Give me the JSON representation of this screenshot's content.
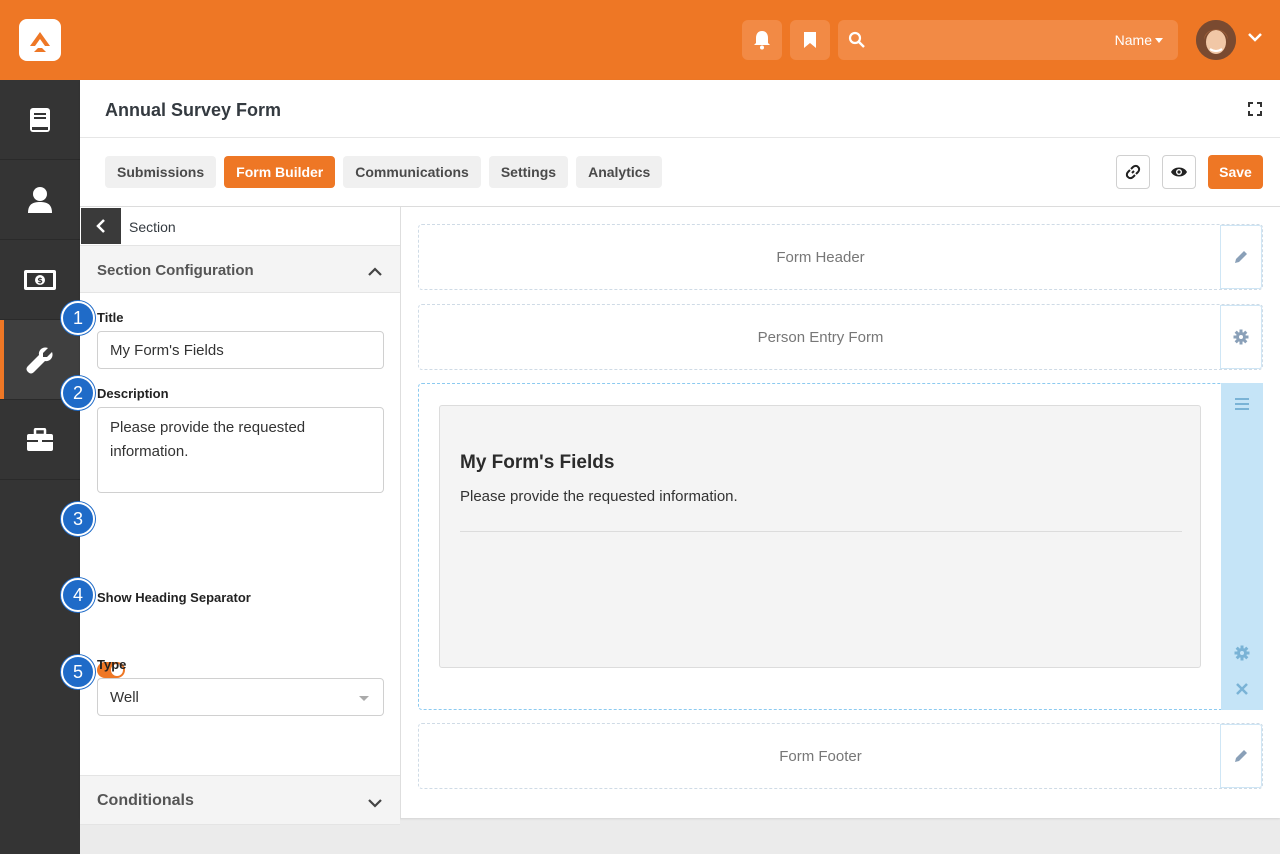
{
  "header": {
    "search_scope": "Name"
  },
  "page": {
    "title": "Annual Survey Form"
  },
  "tabs": [
    {
      "label": "Submissions"
    },
    {
      "label": "Form Builder"
    },
    {
      "label": "Communications"
    },
    {
      "label": "Settings"
    },
    {
      "label": "Analytics"
    }
  ],
  "toolbar": {
    "save_label": "Save"
  },
  "config": {
    "breadcrumb": "Section",
    "section_header": "Section Configuration",
    "title_label": "Title",
    "title_value": "My Form's Fields",
    "description_label": "Description",
    "description_value": "Please provide the requested information.",
    "separator_label": "Show Heading Separator",
    "separator_on": true,
    "type_label": "Type",
    "type_value": "Well",
    "conditionals_label": "Conditionals"
  },
  "badges": [
    "1",
    "2",
    "3",
    "4",
    "5"
  ],
  "builder": {
    "form_header": "Form Header",
    "person_entry": "Person Entry Form",
    "section_title": "My Form's Fields",
    "section_description": "Please provide the requested information.",
    "form_footer": "Form Footer"
  },
  "colors": {
    "brand": "#ee7725",
    "sidebar": "#343434",
    "badge": "#1f6bc8",
    "section_highlight": "#c5e4f7"
  }
}
